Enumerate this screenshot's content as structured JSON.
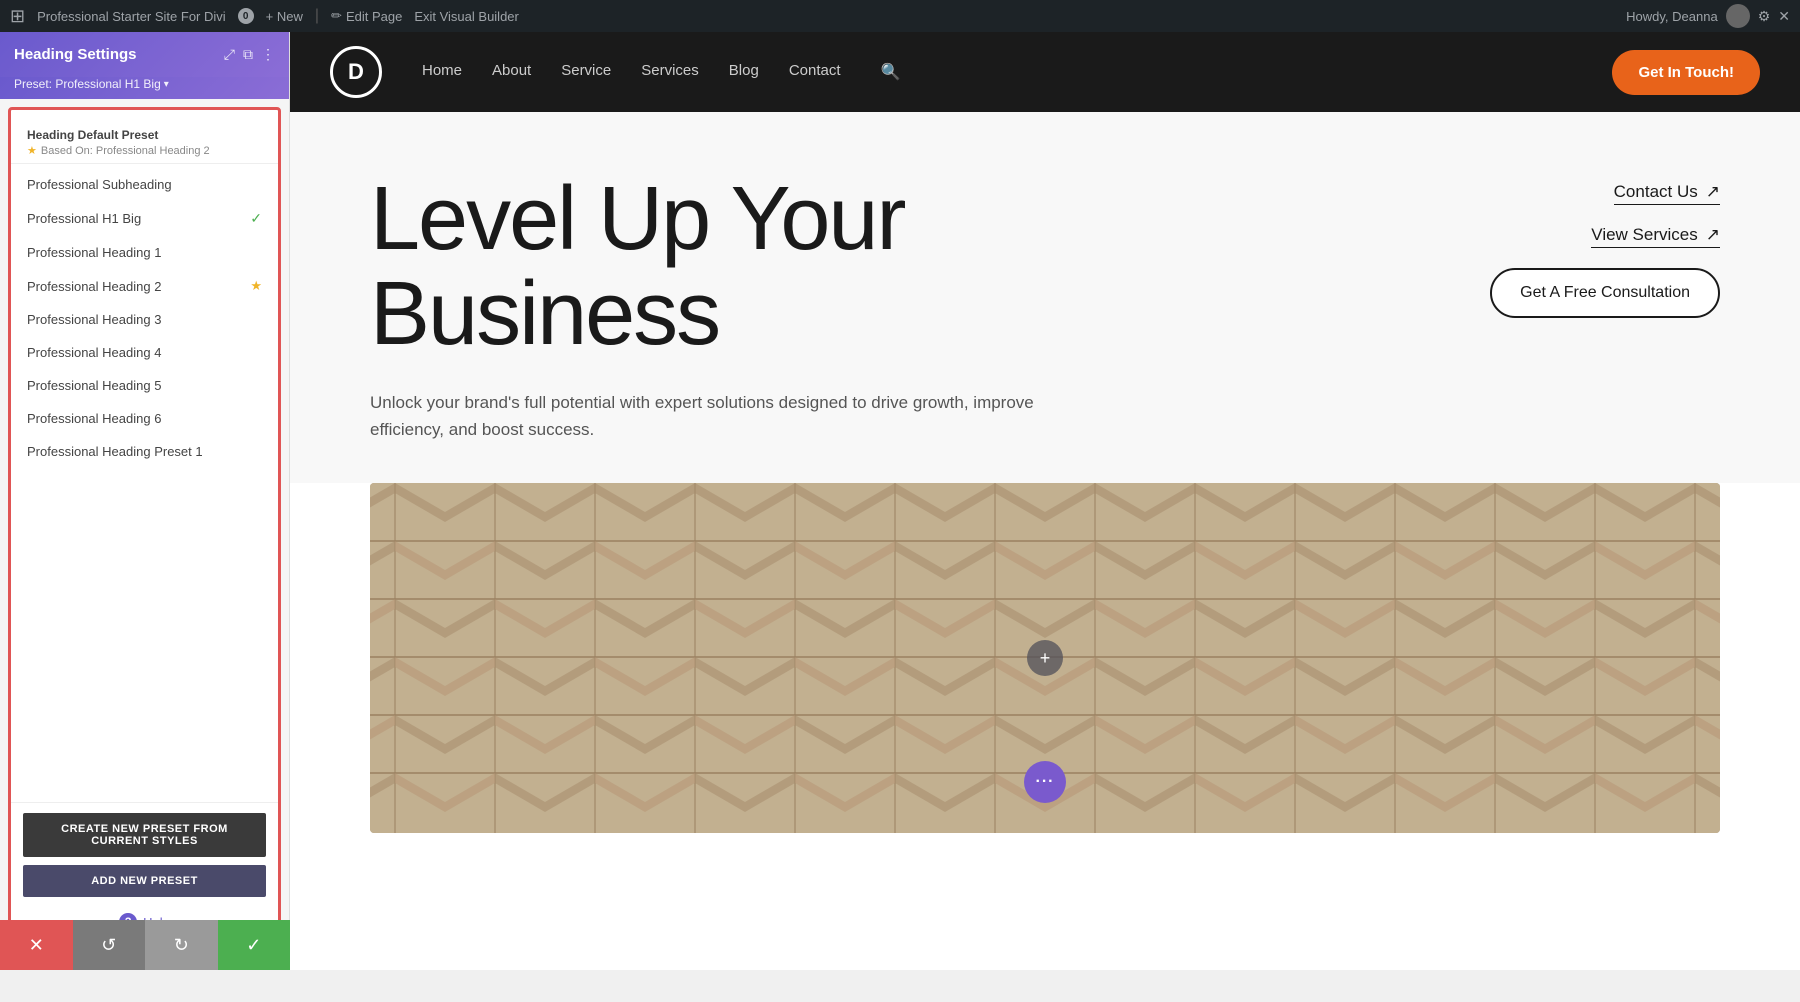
{
  "admin_bar": {
    "wp_logo": "⊞",
    "site_name": "Professional Starter Site For Divi",
    "comment_count": "0",
    "new_label": "+ New",
    "edit_page_label": "Edit Page",
    "exit_builder_label": "Exit Visual Builder",
    "user_greeting": "Howdy, Deanna"
  },
  "panel": {
    "title": "Heading Settings",
    "icons": {
      "fullscreen": "⤢",
      "columns": "⧉",
      "more": "⋮"
    },
    "preset_bar": {
      "label": "Preset: Professional H1 Big",
      "chevron": "▾"
    },
    "dropdown": {
      "section_title": "Heading Default Preset",
      "based_on_label": "Based On: Professional Heading 2",
      "items": [
        {
          "label": "Professional Subheading",
          "active": false,
          "starred": false
        },
        {
          "label": "Professional H1 Big",
          "active": true,
          "starred": false
        },
        {
          "label": "Professional Heading 1",
          "active": false,
          "starred": false
        },
        {
          "label": "Professional Heading 2",
          "active": false,
          "starred": true
        },
        {
          "label": "Professional Heading 3",
          "active": false,
          "starred": false
        },
        {
          "label": "Professional Heading 4",
          "active": false,
          "starred": false
        },
        {
          "label": "Professional Heading 5",
          "active": false,
          "starred": false
        },
        {
          "label": "Professional Heading 6",
          "active": false,
          "starred": false
        },
        {
          "label": "Professional Heading Preset 1",
          "active": false,
          "starred": false
        }
      ],
      "btn_create": "CREATE NEW PRESET FROM CURRENT STYLES",
      "btn_add": "ADD NEW PRESET",
      "help_label": "Help"
    }
  },
  "bottom_toolbar": {
    "cancel_icon": "✕",
    "undo_icon": "↺",
    "redo_icon": "↻",
    "save_icon": "✓"
  },
  "site": {
    "nav": {
      "logo_letter": "D",
      "links": [
        "Home",
        "About",
        "Service",
        "Services",
        "Blog",
        "Contact"
      ],
      "search_icon": "🔍",
      "cta_label": "Get In Touch!"
    },
    "hero": {
      "heading_line1": "Level Up Your",
      "heading_line2": "Business",
      "subtext": "Unlock your brand's full potential with expert solutions designed to drive growth, improve efficiency, and boost success.",
      "link1_label": "Contact Us",
      "link1_arrow": "↗",
      "link2_label": "View Services",
      "link2_arrow": "↗",
      "cta_btn_label": "Get A Free Consultation"
    },
    "image_section": {
      "add_icon": "+",
      "more_icon": "···"
    }
  },
  "colors": {
    "accent_purple": "#6a5acd",
    "accent_orange": "#e8631a",
    "admin_bar_bg": "#1d2327",
    "nav_bg": "#1a1a1a",
    "red_border": "#e05555",
    "green": "#4CAF50",
    "more_btn_purple": "#7a5acd"
  }
}
